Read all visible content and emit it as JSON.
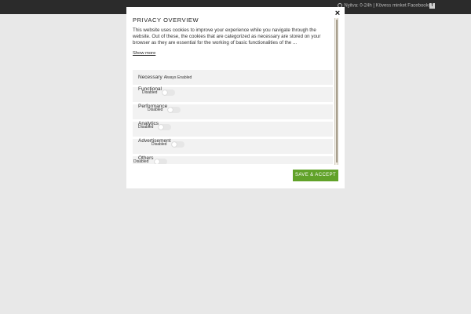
{
  "topbar": {
    "hours_text": "Nyitva: 0-24h | Kövess minket Facebookon!",
    "fb_glyph": "f"
  },
  "modal": {
    "close_glyph": "×",
    "title": "PRIVACY OVERVIEW",
    "description": "This website uses cookies to improve your experience while you navigate through the website. Out of these, the cookies that are categorized as necessary are stored on your browser as they are essential for the working of basic functionalities of the ...",
    "show_more": "Show more",
    "categories": [
      {
        "label": "Necessary",
        "status": "Always Enabled"
      },
      {
        "label": "Functional",
        "status": "Disabled"
      },
      {
        "label": "Performance",
        "status": "Disabled"
      },
      {
        "label": "Analytics",
        "status": "Disabled"
      },
      {
        "label": "Advertisement",
        "status": "Disabled"
      },
      {
        "label": "Others",
        "status": "Disabled"
      }
    ],
    "save_label": "SAVE & ACCEPT",
    "accent_color": "#61a229"
  }
}
